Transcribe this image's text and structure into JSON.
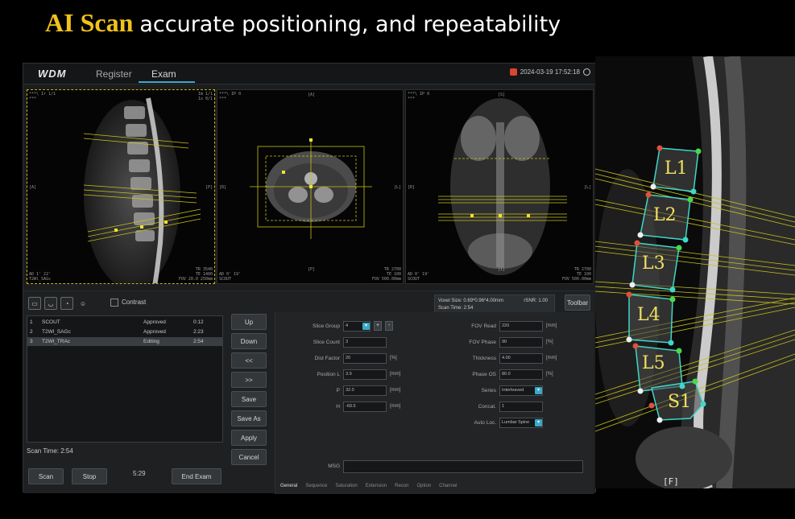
{
  "slide": {
    "title_highlight": "AI Scan",
    "title_rest": "accurate positioning, and repeatability"
  },
  "app": {
    "logo": "WDM",
    "nav": [
      "Register",
      "Exam"
    ],
    "active_nav": "Exam",
    "datetime": "2024-03-19 17:52:18"
  },
  "viewports": [
    {
      "corner_tl": "***\\ Ir 1/1\n***",
      "corner_tr": "Im 1/1\n1x 0/1",
      "side_l": "[A]",
      "side_r": "[P]",
      "corner_bl": "AD 1' 22'\nT2Wl_SAGc",
      "corner_br": "TR 3540\nTE 1400\nFOV 20.0 250mm"
    },
    {
      "corner_tl": "***\\ IP 0\n***",
      "top": "[A]",
      "side_l": "[R]",
      "side_r": "[L]",
      "bottom": "[P]",
      "corner_bl": "AD 0' 19'\nSCOUT",
      "corner_br": "TR 2700\nTE 100\nFOV 500.00mm"
    },
    {
      "corner_tl": "***\\ IP 0\n***",
      "top": "[S]",
      "side_l": "[R]",
      "side_r": "[L]",
      "bottom": "[I]",
      "corner_bl": "AD 0' 19'\nSCOUT",
      "corner_br": "TR 2700\nTE 100\nFOV 500.00mm"
    }
  ],
  "toolbar": {
    "contrast_label": "Contrast",
    "toolbar_button": "Toolbar"
  },
  "info": {
    "voxel_size": "Voxel Size: 0.69*0.96*4.00mm",
    "rsnr": "rSNR: 1.00",
    "scan_time": "Scan Time: 2:54"
  },
  "protocols": [
    {
      "num": "1",
      "name": "SCOUT",
      "status": "Approved",
      "time": "0:12"
    },
    {
      "num": "2",
      "name": "T2Wl_SAGc",
      "status": "Approved",
      "time": "2:23"
    },
    {
      "num": "3",
      "name": "T2Wl_TRAc",
      "status": "Editing",
      "time": "2:54"
    }
  ],
  "side_buttons": [
    "Up",
    "Down",
    "<<",
    ">>",
    "Save",
    "Save As",
    "Apply",
    "Cancel"
  ],
  "bottom": {
    "scan_time": "Scan Time:  2:54",
    "timer": "5:29",
    "scan": "Scan",
    "stop": "Stop",
    "end_exam": "End Exam"
  },
  "params_left": [
    {
      "label": "Slice Group",
      "value": "4",
      "unit": ""
    },
    {
      "label": "Slice Count",
      "value": "3",
      "unit": ""
    },
    {
      "label": "Dist Factor",
      "value": "20",
      "unit": "[%]"
    },
    {
      "label": "Position L",
      "value": "3.9",
      "unit": "[mm]"
    },
    {
      "label": "P",
      "value": "32.0",
      "unit": "[mm]"
    },
    {
      "label": "H",
      "value": "-69.5",
      "unit": "[mm]"
    }
  ],
  "params_right": [
    {
      "label": "FOV Read",
      "value": "220",
      "unit": "[mm]"
    },
    {
      "label": "FOV Phase",
      "value": "90",
      "unit": "[%]"
    },
    {
      "label": "Thickness",
      "value": "4.00",
      "unit": "[mm]"
    },
    {
      "label": "Phase OS",
      "value": "80.0",
      "unit": "[%]"
    },
    {
      "label": "Series",
      "value": "Interleaved",
      "unit": ""
    },
    {
      "label": "Concat.",
      "value": "1",
      "unit": ""
    },
    {
      "label": "Auto Loc.",
      "value": "Lumbar Spine",
      "unit": ""
    }
  ],
  "msg_label": "MSG",
  "tabs": [
    "General",
    "Sequence",
    "Saturation",
    "Extension",
    "Recon",
    "Option",
    "Channel"
  ],
  "active_tab": "General",
  "mri": {
    "vertebra_labels": [
      "L1",
      "L2",
      "L3",
      "L4",
      "L5",
      "S1"
    ],
    "corner_label": "[F]"
  },
  "colors": {
    "accent": "#3ea8c8",
    "title_highlight": "#f2c21b",
    "planning_lines": "#c8c21a",
    "vertebra_outline": "#3fd8c8"
  }
}
